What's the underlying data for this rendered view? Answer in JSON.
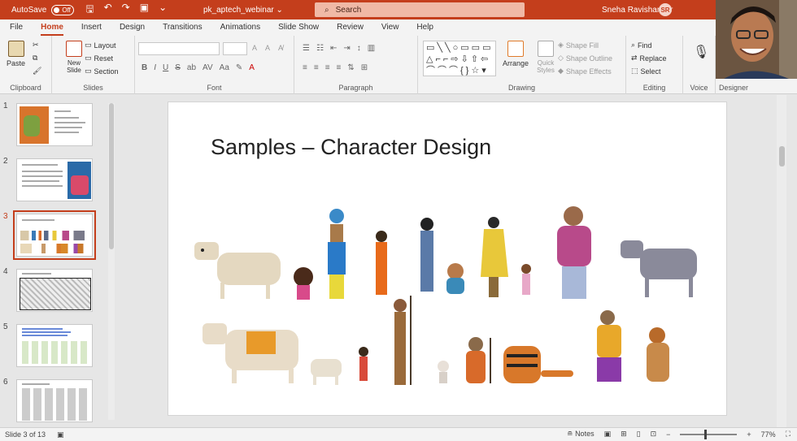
{
  "titlebar": {
    "autosave_label": "AutoSave",
    "autosave_state": "Off",
    "filename": "pk_aptech_webinar",
    "search_placeholder": "Search",
    "user_name": "Sneha Ravishankar",
    "user_initials": "SR"
  },
  "menu": {
    "tabs": [
      "File",
      "Home",
      "Insert",
      "Design",
      "Transitions",
      "Animations",
      "Slide Show",
      "Review",
      "View",
      "Help"
    ],
    "active": "Home"
  },
  "ribbon": {
    "clipboard": {
      "label": "Clipboard",
      "paste": "Paste"
    },
    "slides": {
      "label": "Slides",
      "new_slide": "New Slide",
      "layout": "Layout",
      "reset": "Reset",
      "section": "Section"
    },
    "font": {
      "label": "Font"
    },
    "paragraph": {
      "label": "Paragraph"
    },
    "drawing": {
      "label": "Drawing",
      "arrange": "Arrange",
      "quick_styles": "Quick Styles",
      "shape_fill": "Shape Fill",
      "shape_outline": "Shape Outline",
      "shape_effects": "Shape Effects"
    },
    "editing": {
      "label": "Editing",
      "find": "Find",
      "replace": "Replace",
      "select": "Select"
    },
    "voice": {
      "label": "Voice"
    },
    "designer": {
      "label": "Designer"
    }
  },
  "slides": [
    {
      "num": "1"
    },
    {
      "num": "2"
    },
    {
      "num": "3"
    },
    {
      "num": "4"
    },
    {
      "num": "5"
    },
    {
      "num": "6"
    }
  ],
  "current_slide": {
    "title": "Samples – Character Design"
  },
  "status": {
    "slide_info": "Slide 3 of 13",
    "notes": "Notes",
    "zoom": "77%"
  },
  "colors": {
    "accent": "#c43e1c",
    "selected_thumb": "#c43e1c"
  }
}
